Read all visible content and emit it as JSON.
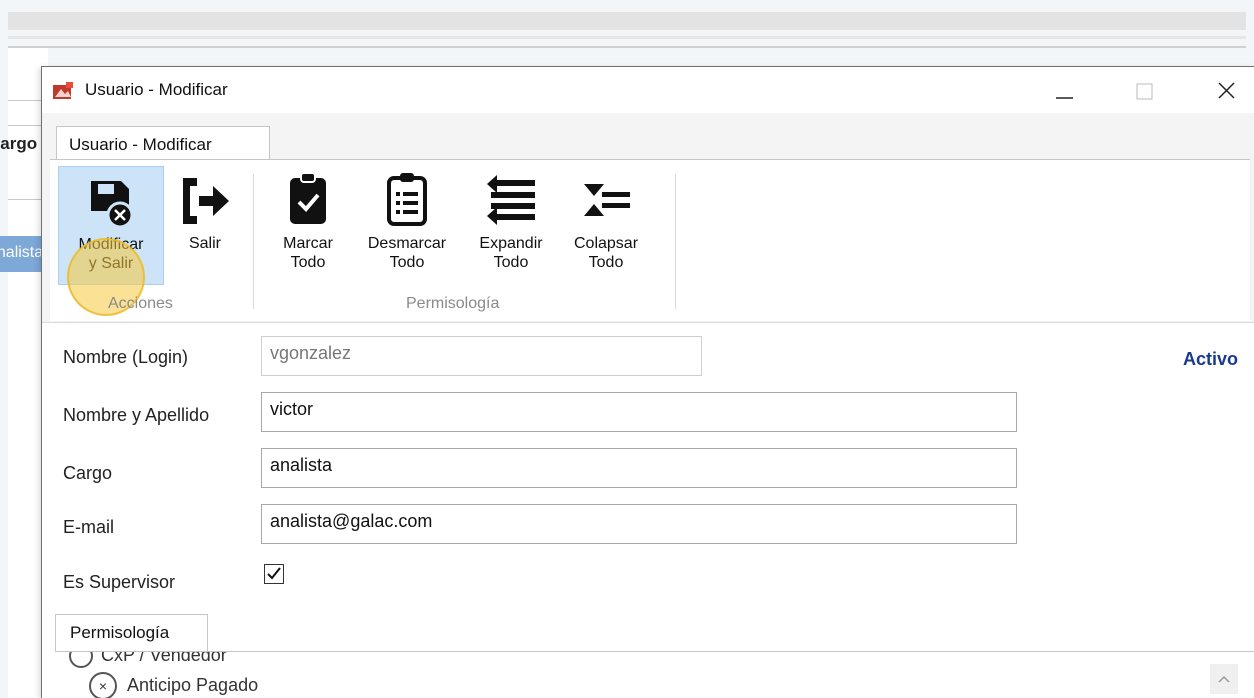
{
  "background_app": {
    "column_header": "Cargo",
    "selected_cell": "analista"
  },
  "window": {
    "title": "Usuario - Modificar",
    "minimize_icon": "minimize-icon",
    "maximize_icon": "maximize-icon",
    "close_icon": "close-icon"
  },
  "ribbon": {
    "tab_label": "Usuario - Modificar",
    "groups": [
      {
        "label": "Acciones"
      },
      {
        "label": "Permisología"
      }
    ],
    "buttons": {
      "modificar_line1": "Modificar",
      "modificar_line2": "y Salir",
      "salir": "Salir",
      "marcar_line1": "Marcar",
      "marcar_line2": "Todo",
      "desmarcar_line1": "Desmarcar",
      "desmarcar_line2": "Todo",
      "expandir_line1": "Expandir",
      "expandir_line2": "Todo",
      "colapsar_line1": "Colapsar",
      "colapsar_line2": "Todo"
    }
  },
  "form": {
    "login_label": "Nombre (Login)",
    "login_value": "vgonzalez",
    "status": "Activo",
    "name_label": "Nombre y Apellido",
    "name_value": "victor",
    "cargo_label": "Cargo",
    "cargo_value": "analista",
    "email_label": "E-mail",
    "email_value": "analista@galac.com",
    "supervisor_label": "Es Supervisor",
    "supervisor_checked": true
  },
  "permissions": {
    "tab_label": "Permisología",
    "rows": [
      "CxP / Vendedor",
      "Anticipo Pagado"
    ]
  },
  "colors": {
    "accent": "#1a3a8f",
    "ribbon_selected": "#cde3f7",
    "click_highlight": "#f5c83c"
  }
}
